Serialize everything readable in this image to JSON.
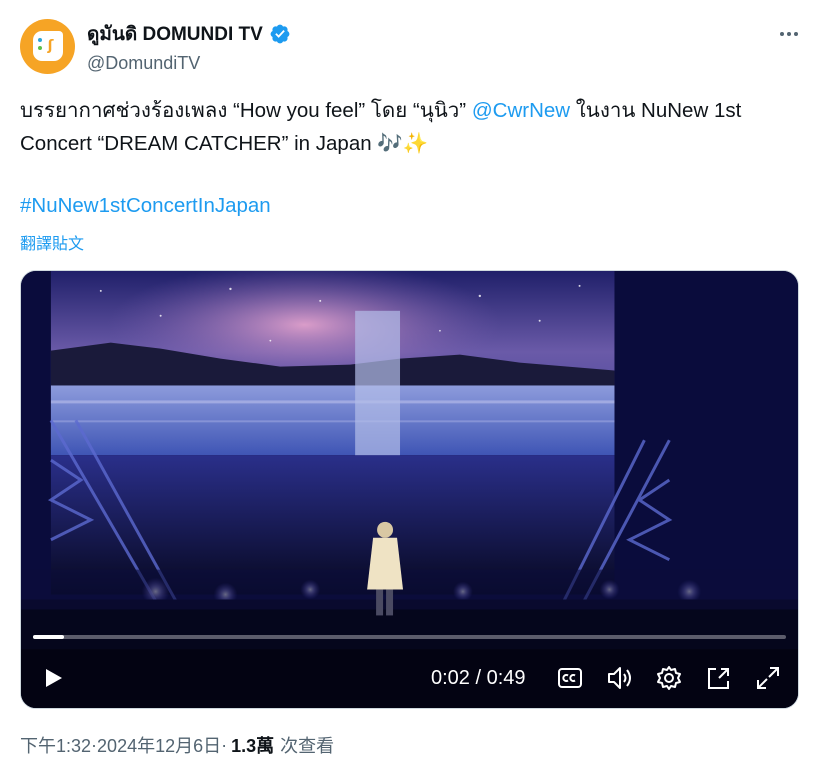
{
  "author": {
    "display_name": "ดูมันดิ DOMUNDI TV",
    "handle": "@DomundiTV",
    "avatar_icon": "domundi-logo",
    "avatar_color": "#f6a425",
    "verified_icon": "verified-badge-icon",
    "verified_color": "#1d9bf0"
  },
  "tweet": {
    "text_part1": "บรรยากาศช่วงร้องเพลง “How you feel” โดย “นุนิว” ",
    "mention": "@CwrNew",
    "text_part2": " ในงาน NuNew 1st Concert “DREAM CATCHER” in Japan ",
    "emoji": "🎶✨",
    "hashtag": "#NuNew1stConcertInJapan",
    "translate_label": "翻譯貼文",
    "link_color": "#1d9bf0"
  },
  "video": {
    "current_time": "0:02",
    "separator": " / ",
    "duration": "0:49",
    "progress": 0.041
  },
  "meta": {
    "time": "下午1:32",
    "dot1": " · ",
    "date": "2024年12月6日",
    "dot2": " · ",
    "views": "1.3萬",
    "views_label": "次查看"
  }
}
